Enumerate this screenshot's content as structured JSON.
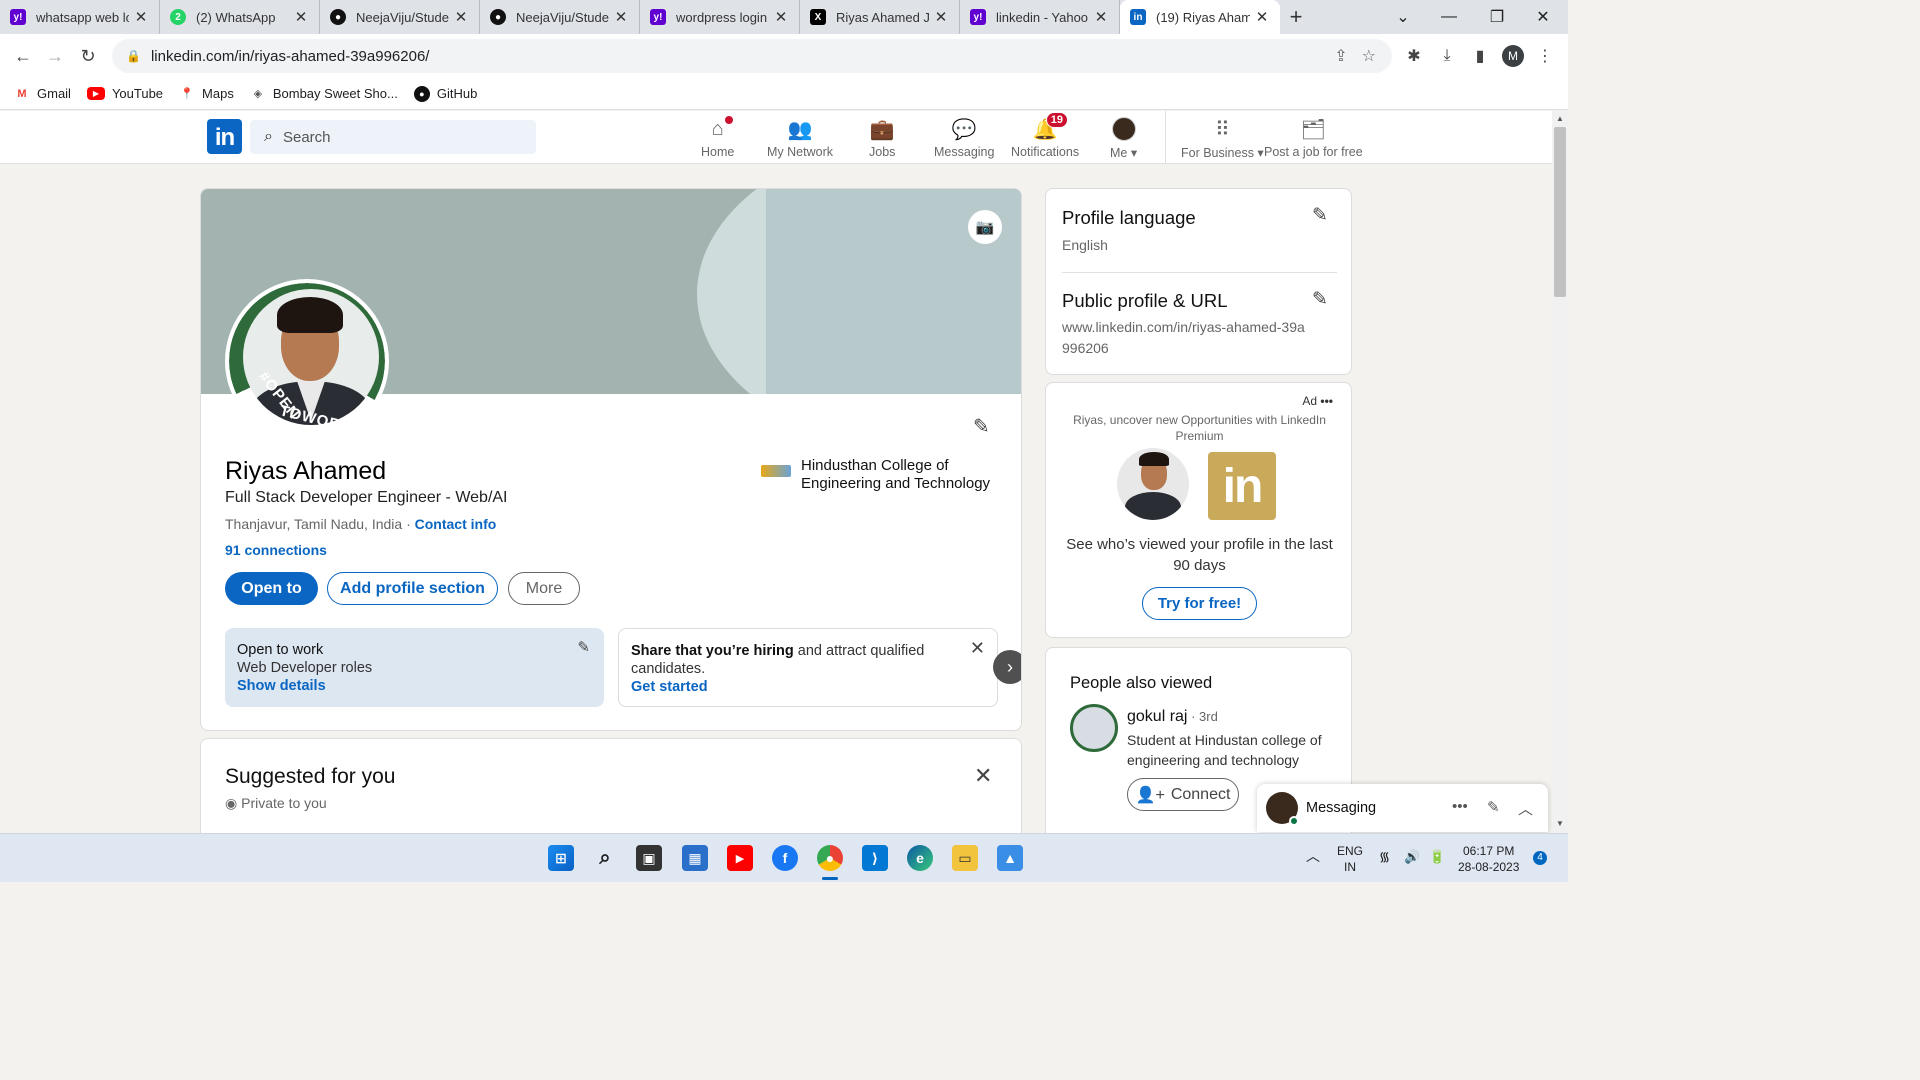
{
  "browser": {
    "tabs": [
      {
        "title": "whatsapp web log",
        "favicon": "yahoo-icon",
        "color": "#6001d2"
      },
      {
        "title": "(2) WhatsApp",
        "favicon": "whatsapp-icon",
        "color": "#25d366"
      },
      {
        "title": "NeejaViju/Studen",
        "favicon": "github-icon",
        "color": "#111111"
      },
      {
        "title": "NeejaViju/Studen",
        "favicon": "github-icon",
        "color": "#111111"
      },
      {
        "title": "wordpress login -",
        "favicon": "yahoo-icon",
        "color": "#6001d2"
      },
      {
        "title": "Riyas Ahamed J (",
        "favicon": "x-icon",
        "color": "#000000"
      },
      {
        "title": "linkedin - Yahoo",
        "favicon": "yahoo-icon",
        "color": "#6001d2"
      },
      {
        "title": "(19) Riyas Ahame",
        "favicon": "linkedin-icon",
        "color": "#0a66c2"
      }
    ],
    "url": "linkedin.com/in/riyas-ahamed-39a996206/",
    "profile_initial": "M",
    "bookmarks": [
      {
        "label": "Gmail",
        "icon": "gmail-icon"
      },
      {
        "label": "YouTube",
        "icon": "youtube-icon"
      },
      {
        "label": "Maps",
        "icon": "maps-icon"
      },
      {
        "label": "Bombay Sweet Sho...",
        "icon": "bookmark-icon"
      },
      {
        "label": "GitHub",
        "icon": "github-icon"
      }
    ]
  },
  "linkedin": {
    "search_placeholder": "Search",
    "nav": {
      "home": "Home",
      "network": "My Network",
      "jobs": "Jobs",
      "messaging": "Messaging",
      "notifications": "Notifications",
      "notifications_count": "19",
      "me": "Me",
      "business": "For Business",
      "post_job": "Post a job for free"
    },
    "profile": {
      "name": "Riyas Ahamed",
      "headline": "Full Stack Developer Engineer - Web/AI",
      "location": "Thanjavur, Tamil Nadu, India",
      "contact_link": "Contact info",
      "connections": "91 connections",
      "education": "Hindusthan College of Engineering and Technology",
      "frame_text_1": "#OPEN",
      "frame_text_2": "TOWORK",
      "btn_open_to": "Open to",
      "btn_add_section": "Add profile section",
      "btn_more": "More",
      "otw_title": "Open to work",
      "otw_roles": "Web Developer roles",
      "otw_link": "Show details",
      "hire_bold": "Share that you’re hiring",
      "hire_rest": " and attract qualified candidates.",
      "hire_link": "Get started"
    },
    "suggested": {
      "title": "Suggested for you",
      "subtitle": "Private to you"
    },
    "sidebar": {
      "lang_title": "Profile language",
      "lang_value": "English",
      "url_title": "Public profile & URL",
      "url_value": "www.linkedin.com/in/riyas-ahamed-39a996206",
      "ad_label": "Ad",
      "ad_text": "Riyas, uncover new Opportunities with LinkedIn Premium",
      "ad_logo": "in",
      "ad_body": "See who’s viewed your profile in the last 90 days",
      "ad_button": "Try for free!",
      "pav_title": "People also viewed",
      "pav_name": "gokul raj",
      "pav_degree": " · 3rd",
      "pav_desc": "Student at Hindustan college of engineering and technology",
      "pav_button": "Connect"
    },
    "messaging_bar": "Messaging"
  },
  "taskbar": {
    "lang_1": "ENG",
    "lang_2": "IN",
    "time": "06:17 PM",
    "date": "28-08-2023",
    "notif_count": "4"
  }
}
